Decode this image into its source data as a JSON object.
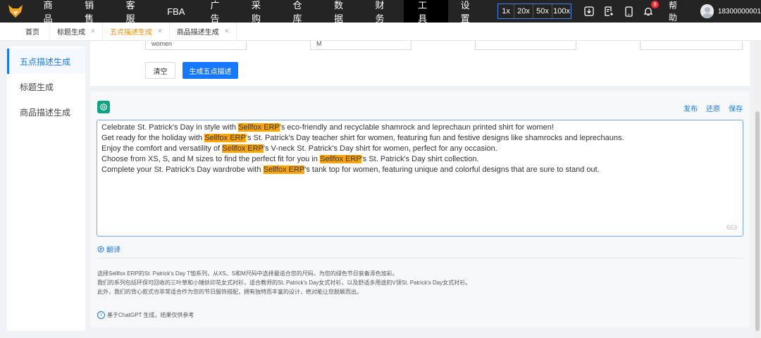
{
  "nav": {
    "items": [
      {
        "label": "商品"
      },
      {
        "label": "销售"
      },
      {
        "label": "客服"
      },
      {
        "label": "FBA"
      },
      {
        "label": "广告"
      },
      {
        "label": "采购"
      },
      {
        "label": "仓库"
      },
      {
        "label": "数据"
      },
      {
        "label": "财务"
      },
      {
        "label": "工具"
      },
      {
        "label": "设置"
      }
    ],
    "active": "工具",
    "zoom": [
      "1x",
      "20x",
      "50x",
      "100x"
    ],
    "notification_count": "8",
    "help": "帮助",
    "username": "18300000001"
  },
  "tabs": [
    {
      "label": "首页"
    },
    {
      "label": "标题生成"
    },
    {
      "label": "五点描述生成"
    },
    {
      "label": "商品描述生成"
    }
  ],
  "sidebar": {
    "items": [
      {
        "label": "五点描述生成"
      },
      {
        "label": "标题生成"
      },
      {
        "label": "商品描述生成"
      }
    ]
  },
  "form": {
    "field1_value": "women",
    "field2_value": "M",
    "clear_label": "清空",
    "generate_label": "生成五点描述"
  },
  "result": {
    "actions": {
      "publish": "发布",
      "restore": "还原",
      "save": "保存"
    },
    "brand": "Sellfox ERP",
    "lines": [
      {
        "pre": "Celebrate St. Patrick's Day in style with ",
        "post": "'s eco-friendly and recyclable shamrock and leprechaun printed shirt for women!"
      },
      {
        "pre": "Get ready for the holiday with ",
        "post": "'s St. Patrick's Day teacher shirt for women, featuring fun and festive designs like shamrocks and leprechauns."
      },
      {
        "pre": "Enjoy the comfort and versatility of ",
        "post": "'s V-neck St. Patrick's Day shirt for women, perfect for any occasion."
      },
      {
        "pre": "Choose from XS, S, and M sizes to find the perfect fit for you in ",
        "post": "'s St. Patrick's Day shirt collection."
      },
      {
        "pre": "Complete your St. Patrick's Day wardrobe with ",
        "post": "'s tank top for women, featuring unique and colorful designs that are sure to stand out."
      }
    ],
    "char_count": "663",
    "translate_label": "翻译",
    "translation": [
      "选择Sellfox ERP的St. Patrick's Day T恤系列，从XS、S和M尺码中选择最适合您的尺码，为您的绿色节日装备添色加彩。",
      "我们的系列包括环保可回收的三叶草和小矮妖印花女式衬衫，适合教师的St. Patrick's Day女式衬衫，以及舒适多用途的V领St. Patrick's Day女式衬衫。",
      "此外，我们的背心款式也非常适合作为您的节日服饰搭配，拥有独特而丰富的设计，绝对能让您脱颖而出。"
    ],
    "note": "基于ChatGPT 生成，结果仅供参考"
  },
  "colors": {
    "accent": "#1677ff",
    "highlight": "#ffa500",
    "nav_bg": "#242424",
    "active_tab": "#ff8c00"
  }
}
